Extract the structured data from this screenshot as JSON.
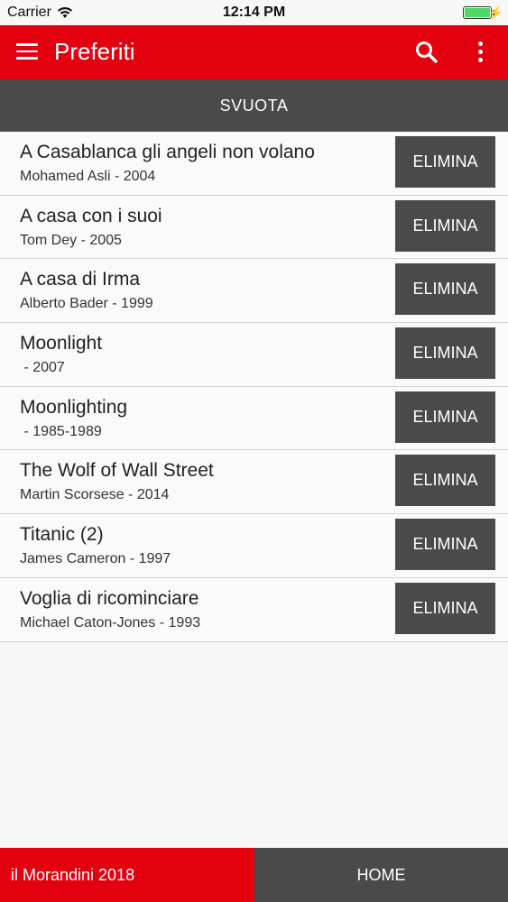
{
  "status": {
    "carrier": "Carrier",
    "time": "12:14 PM"
  },
  "app_bar": {
    "title": "Preferiti",
    "accent": "#e3000f"
  },
  "clear_button": {
    "label": "SVUOTA"
  },
  "items": [
    {
      "title": "A Casablanca gli angeli non volano",
      "subtitle": "Mohamed Asli - 2004",
      "action": "ELIMINA"
    },
    {
      "title": "A casa con i suoi",
      "subtitle": "Tom Dey - 2005",
      "action": "ELIMINA"
    },
    {
      "title": "A casa di Irma",
      "subtitle": "Alberto Bader - 1999",
      "action": "ELIMINA"
    },
    {
      "title": "Moonlight",
      "subtitle": " - 2007",
      "action": "ELIMINA"
    },
    {
      "title": "Moonlighting",
      "subtitle": " - 1985-1989",
      "action": "ELIMINA"
    },
    {
      "title": "The Wolf of Wall Street",
      "subtitle": "Martin Scorsese - 2014",
      "action": "ELIMINA"
    },
    {
      "title": "Titanic (2)",
      "subtitle": "James Cameron - 1997",
      "action": "ELIMINA"
    },
    {
      "title": "Voglia di ricominciare",
      "subtitle": "Michael Caton-Jones - 1993",
      "action": "ELIMINA"
    }
  ],
  "bottom_bar": {
    "brand_label": "il Morandini 2018",
    "home_label": "HOME"
  }
}
